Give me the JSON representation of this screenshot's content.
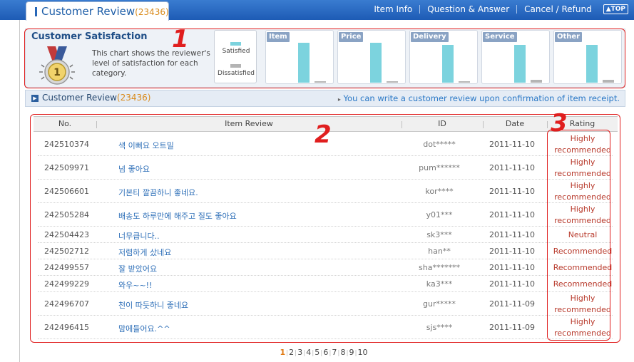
{
  "header": {
    "title": "Customer Review",
    "count": "(23436)",
    "nav": [
      "Item Info",
      "Question & Answer",
      "Cancel / Refund"
    ],
    "top_button": "TOP"
  },
  "satisfaction": {
    "title": "Customer Satisfaction",
    "description": "This chart shows the reviewer's level of satisfaction for each category.",
    "legend": {
      "satisfied": "Satisfied",
      "dissatisfied": "Dissatisfied"
    },
    "colors": {
      "satisfied": "#7cd3de",
      "dissatisfied": "#b4b4b4"
    },
    "charts": [
      {
        "label": "Item",
        "satisfied": 0.93,
        "dissatisfied": 0.03
      },
      {
        "label": "Price",
        "satisfied": 0.93,
        "dissatisfied": 0.02
      },
      {
        "label": "Delivery",
        "satisfied": 0.89,
        "dissatisfied": 0.04
      },
      {
        "label": "Service",
        "satisfied": 0.89,
        "dissatisfied": 0.06
      },
      {
        "label": "Other",
        "satisfied": 0.89,
        "dissatisfied": 0.06
      }
    ]
  },
  "review_bar": {
    "title": "Customer Review",
    "count": "(23436)",
    "note": "You can write a customer review upon confirmation of item receipt."
  },
  "table": {
    "headers": {
      "no": "No.",
      "review": "Item Review",
      "id": "ID",
      "date": "Date",
      "rating": "Rating"
    },
    "rows": [
      {
        "no": "242510374",
        "review": "색 이뻐요 오트밀",
        "id": "dot*****",
        "date": "2011-11-10",
        "rating": "Highly recommended"
      },
      {
        "no": "242509971",
        "review": "넘 좋아요",
        "id": "pum******",
        "date": "2011-11-10",
        "rating": "Highly recommended"
      },
      {
        "no": "242506601",
        "review": "기본티 깔끔하니 좋네요.",
        "id": "kor****",
        "date": "2011-11-10",
        "rating": "Highly recommended"
      },
      {
        "no": "242505284",
        "review": "배송도 하루만에 해주고 질도 좋아요",
        "id": "y01***",
        "date": "2011-11-10",
        "rating": "Highly recommended"
      },
      {
        "no": "242504423",
        "review": "너무큽니다..",
        "id": "sk3***",
        "date": "2011-11-10",
        "rating": "Neutral"
      },
      {
        "no": "242502712",
        "review": "저렴하게 샀네요",
        "id": "han**",
        "date": "2011-11-10",
        "rating": "Recommended"
      },
      {
        "no": "242499557",
        "review": "잘 받았어요",
        "id": "sha*******",
        "date": "2011-11-10",
        "rating": "Recommended"
      },
      {
        "no": "242499229",
        "review": "와우~~!!",
        "id": "ka3***",
        "date": "2011-11-10",
        "rating": "Recommended"
      },
      {
        "no": "242496707",
        "review": "천이 따듯하니 좋네요",
        "id": "gur*****",
        "date": "2011-11-09",
        "rating": "Highly recommended"
      },
      {
        "no": "242496415",
        "review": "맘에들어요.^^",
        "id": "sjs****",
        "date": "2011-11-09",
        "rating": "Highly recommended"
      }
    ]
  },
  "pagination": {
    "pages": [
      "1",
      "2",
      "3",
      "4",
      "5",
      "6",
      "7",
      "8",
      "9",
      "10"
    ],
    "current": "1"
  },
  "annotations": [
    "1",
    "2",
    "3"
  ],
  "annotation_color": "#e01e1e"
}
